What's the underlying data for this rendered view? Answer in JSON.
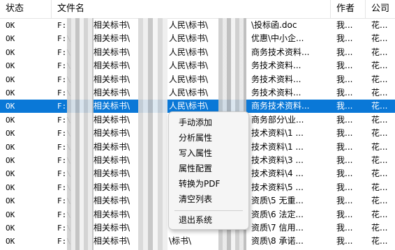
{
  "columns": {
    "status": "状态",
    "filename": "文件名",
    "author": "作者",
    "company": "公司"
  },
  "rows": [
    {
      "status": "OK",
      "drive": "F:",
      "seg1": "相关标书\\",
      "seg2": "人民\\标书\\",
      "seg3": "\\投标函.doc",
      "author": "我...",
      "company": "花..."
    },
    {
      "status": "OK",
      "drive": "F:\\",
      "seg1": "相关标书\\",
      "seg2": "人民\\标书\\",
      "seg3": "优惠\\中小企...",
      "author": "我...",
      "company": "花..."
    },
    {
      "status": "OK",
      "drive": "F:\\",
      "seg1": "相关标书\\",
      "seg2": "人民\\标书\\",
      "seg3": "商务技术资料...",
      "author": "我...",
      "company": "花..."
    },
    {
      "status": "OK",
      "drive": "F:\\",
      "seg1": "相关标书\\",
      "seg2": "人民\\标书\\",
      "seg3": "务技术资料...",
      "author": "我...",
      "company": "花..."
    },
    {
      "status": "OK",
      "drive": "F:\\",
      "seg1": "相关标书\\",
      "seg2": "人民\\标书\\",
      "seg3": "务技术资料...",
      "author": "我...",
      "company": "花..."
    },
    {
      "status": "OK",
      "drive": "F:\\",
      "seg1": "相关标书\\",
      "seg2": "人民\\标书\\",
      "seg3": "务技术资料...",
      "author": "我...",
      "company": "花..."
    },
    {
      "status": "OK",
      "drive": "F:",
      "seg1": "相关标书\\",
      "seg2": "人民\\标书\\",
      "seg3": "商务技术资料...",
      "author": "我...",
      "company": "花..."
    },
    {
      "status": "OK",
      "drive": "F:\\",
      "seg1": "相关标书\\",
      "seg2": "",
      "seg3": "商务部分\\业...",
      "author": "我...",
      "company": "花..."
    },
    {
      "status": "OK",
      "drive": "F:\\",
      "seg1": "相关标书\\",
      "seg2": "",
      "seg3": "技术资料\\1 ...",
      "author": "我...",
      "company": "花..."
    },
    {
      "status": "OK",
      "drive": "F:\\",
      "seg1": "相关标书\\",
      "seg2": "",
      "seg3": "技术资料\\1 ...",
      "author": "我...",
      "company": "花..."
    },
    {
      "status": "OK",
      "drive": "F:\\",
      "seg1": "相关标书\\",
      "seg2": "",
      "seg3": "技术资料\\3 ...",
      "author": "我...",
      "company": "花..."
    },
    {
      "status": "OK",
      "drive": "F:\\",
      "seg1": "相关标书\\",
      "seg2": "",
      "seg3": "技术资料\\4 ...",
      "author": "我...",
      "company": "花..."
    },
    {
      "status": "OK",
      "drive": "F:\\",
      "seg1": "相关标书\\",
      "seg2": "",
      "seg3": "技术资料\\5 ...",
      "author": "我...",
      "company": "花..."
    },
    {
      "status": "OK",
      "drive": "F:\\",
      "seg1": "相关标书\\",
      "seg2": "",
      "seg3": "资质\\5 无重...",
      "author": "我...",
      "company": "花..."
    },
    {
      "status": "OK",
      "drive": "F:\\",
      "seg1": "相关标书\\",
      "seg2": "",
      "seg3": "资质\\6 法定...",
      "author": "我...",
      "company": "花..."
    },
    {
      "status": "OK",
      "drive": "F:\\",
      "seg1": "相关标书\\",
      "seg2": "",
      "seg3": "资质\\7 信用...",
      "author": "我...",
      "company": "花..."
    },
    {
      "status": "OK",
      "drive": "F:\\",
      "seg1": "相关标书\\",
      "seg2": "\\标书\\",
      "seg3": "资质\\8  承诺...",
      "author": "我...",
      "company": "花..."
    }
  ],
  "selected_row_index": 6,
  "context_menu": {
    "items": [
      "手动添加",
      "分析属性",
      "写入属性",
      "属性配置",
      "转换为PDF",
      "清空列表"
    ],
    "exit": "退出系统"
  },
  "colors": {
    "selection": "#0a78d7",
    "menu_bg": "#f5f5f5",
    "header_divider": "#e5e5e5"
  }
}
